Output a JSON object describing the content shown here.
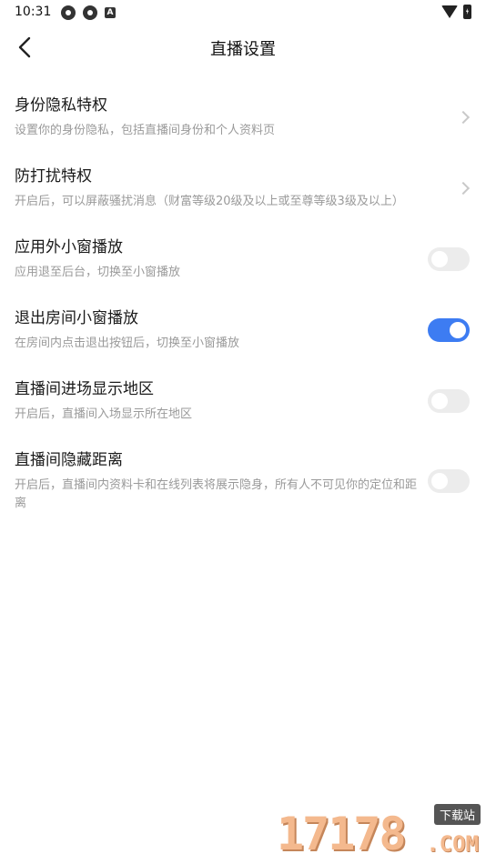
{
  "statusbar": {
    "time": "10:31",
    "left_icons": [
      "notification-icon",
      "notification-icon",
      "app-icon"
    ],
    "app_icon_letter": "A",
    "right_icons": [
      "wifi-icon",
      "battery-icon"
    ]
  },
  "appbar": {
    "title": "直播设置",
    "back_icon": "chevron-left-icon"
  },
  "settings": [
    {
      "title": "身份隐私特权",
      "desc": "设置你的身份隐私，包括直播间身份和个人资料页",
      "control": "chevron"
    },
    {
      "title": "防打扰特权",
      "desc": "开启后，可以屏蔽骚扰消息（财富等级20级及以上或至尊等级3级及以上）",
      "control": "chevron"
    },
    {
      "title": "应用外小窗播放",
      "desc": "应用退至后台，切换至小窗播放",
      "control": "toggle",
      "on": false
    },
    {
      "title": "退出房间小窗播放",
      "desc": "在房间内点击退出按钮后，切换至小窗播放",
      "control": "toggle",
      "on": true
    },
    {
      "title": "直播间进场显示地区",
      "desc": "开启后，直播间入场显示所在地区",
      "control": "toggle",
      "on": false
    },
    {
      "title": "直播间隐藏距离",
      "desc": "开启后，直播间内资料卡和在线列表将展示隐身，所有人不可见你的定位和距离",
      "control": "toggle",
      "on": false
    }
  ],
  "watermark": {
    "digits": "17178",
    "tag": "下载站",
    "suffix": ".COM"
  },
  "colors": {
    "accent": "#3d7cf2",
    "toggle_off": "#ececec",
    "desc_text": "#9a9a9a"
  }
}
